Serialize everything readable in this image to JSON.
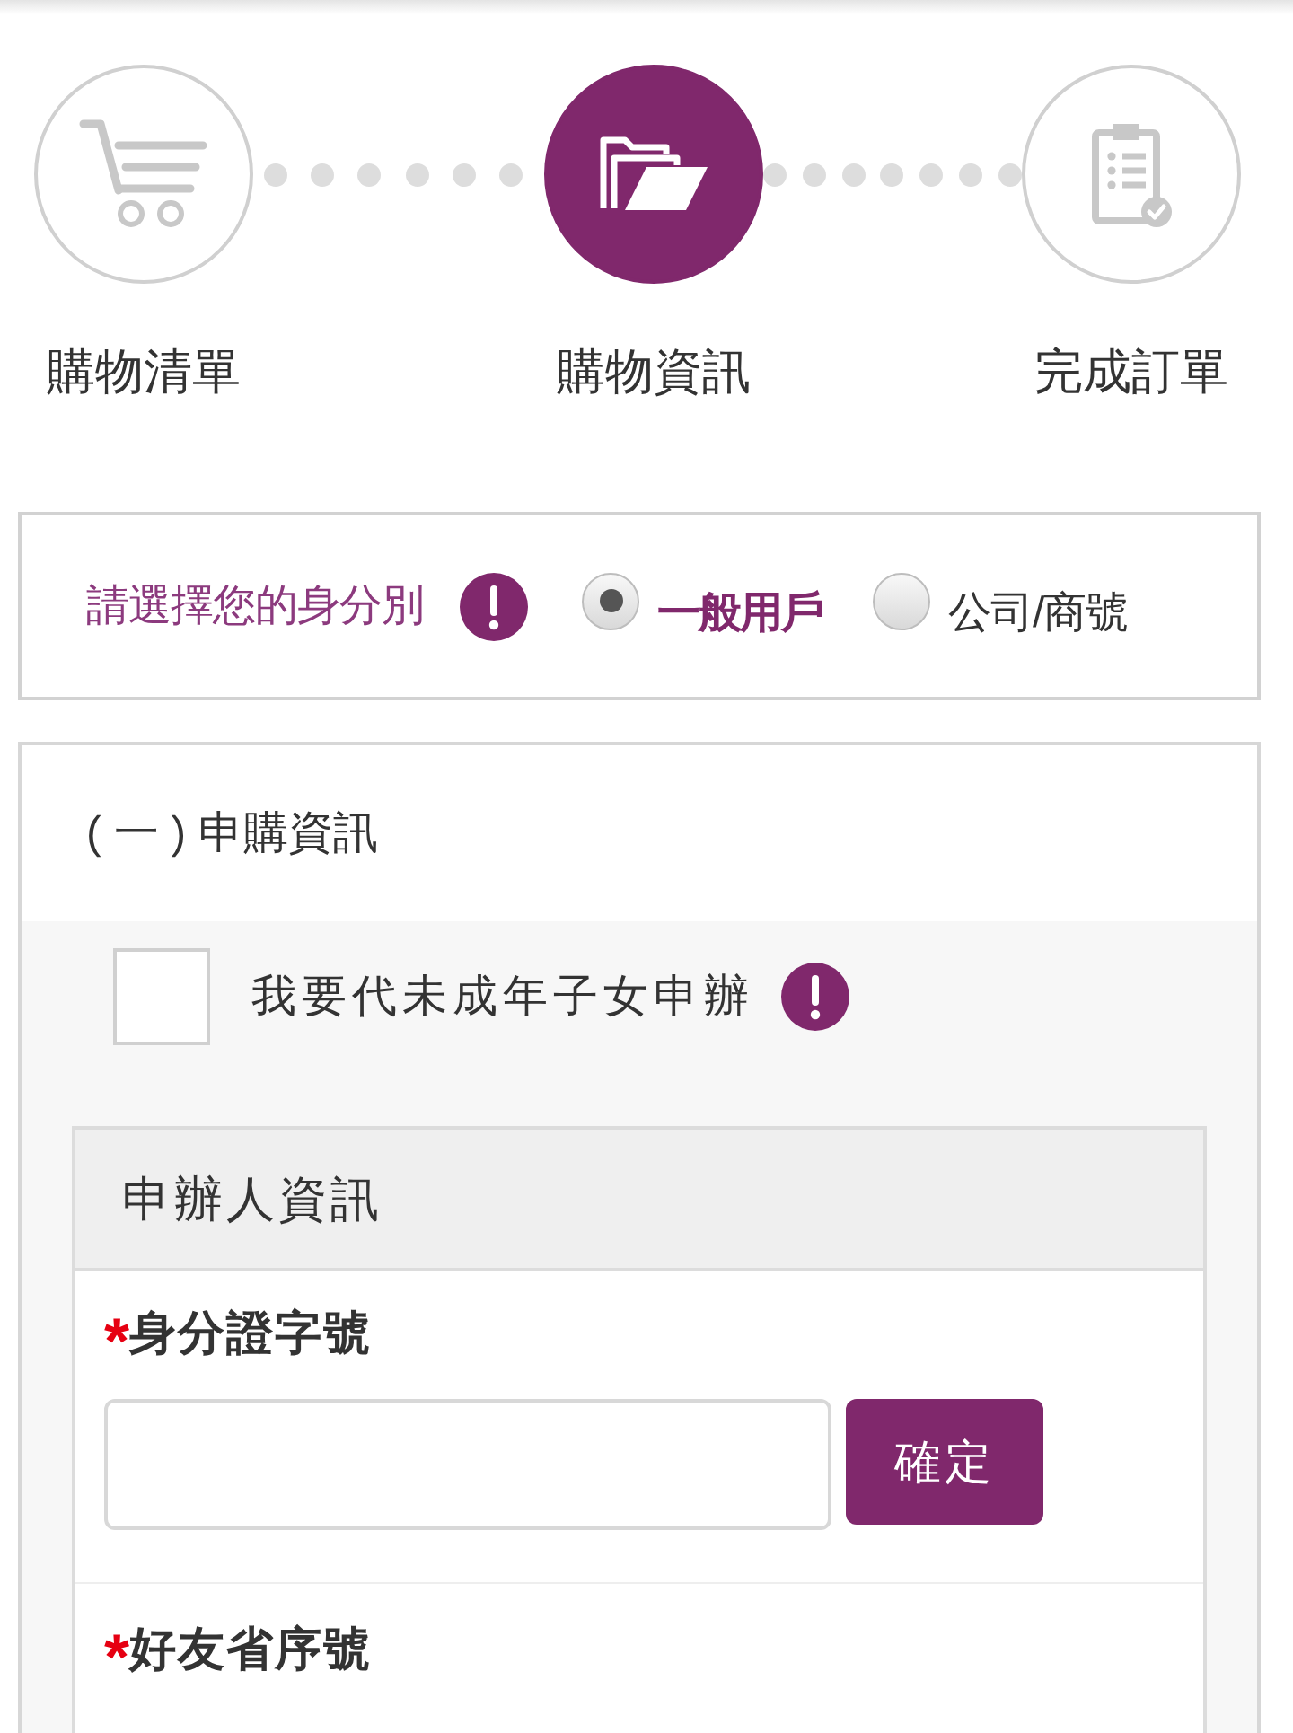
{
  "steps": [
    {
      "label": "購物清單",
      "selected": false
    },
    {
      "label": "購物資訊",
      "selected": true
    },
    {
      "label": "完成訂單",
      "selected": false
    }
  ],
  "identity": {
    "prompt": "請選擇您的身分別",
    "options": [
      {
        "label": "一般用戶",
        "selected": true
      },
      {
        "label": "公司/商號",
        "selected": false
      }
    ]
  },
  "application": {
    "title": "( 一 ) 申購資訊",
    "minor_option": {
      "label": "我要代未成年子女申辦",
      "checked": false
    },
    "applicant": {
      "title": "申辦人資訊",
      "fields": [
        {
          "kind": "input_button",
          "required_mark": "*",
          "label": "身分證字號",
          "button": "確定"
        },
        {
          "kind": "label_only",
          "required_mark": "*",
          "label": "好友省序號"
        }
      ]
    }
  }
}
